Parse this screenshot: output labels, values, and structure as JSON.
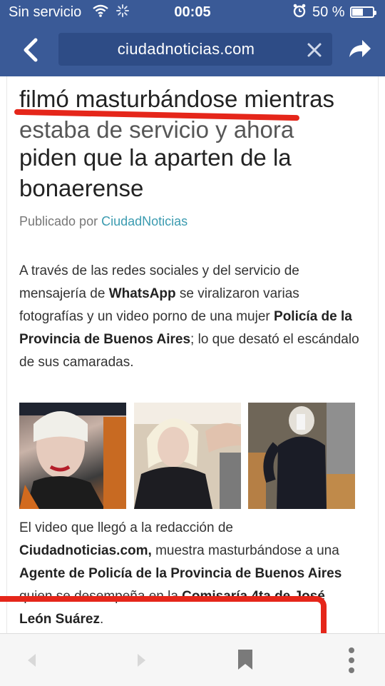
{
  "status_bar": {
    "carrier": "Sin servicio",
    "time": "00:05",
    "battery_percent": "50 %",
    "battery_level": 0.5,
    "icons": [
      "wifi-icon",
      "activity-spinner-icon",
      "alarm-icon",
      "battery-icon"
    ]
  },
  "browser": {
    "url": "ciudadnoticias.com",
    "icons": [
      "back-arrow-icon",
      "clear-icon",
      "share-icon",
      "nav-back-icon",
      "nav-forward-icon",
      "bookmark-icon",
      "more-icon"
    ]
  },
  "article": {
    "headline_line_1": "filmó masturbándose mientras",
    "headline_line_2": "estaba de servicio y ahora",
    "headline_line_3": "piden que la aparten de la",
    "headline_line_4": "bonaerense",
    "byline_prefix": "Publicado por",
    "byline_author": "CiudadNoticias",
    "paragraph_1": {
      "t1": "A través de las redes sociales  y del servicio de mensajería de ",
      "b1": "WhatsApp",
      "t2": " se viralizaron varias fotografías y un video porno de una mujer ",
      "b2": "Policía de la Provincia de Buenos Aires",
      "t3": "; lo que desató el escándalo de sus camaradas."
    },
    "paragraph_2": {
      "t1": "El video que llegó a la redacción de ",
      "b1": "Ciudadnoticias.com,",
      "t2": "   muestra masturbándose  a  una ",
      "b2": "Agente de Policía de la Provincia de Buenos Aires",
      "t3": " quien se desempeña en la ",
      "b3": "Comisaría 4ta de José León Suárez",
      "t4": "."
    }
  },
  "colors": {
    "browser_bar": "#3a5a97",
    "url_field": "#2e4c86",
    "annotation_red": "#e5261a",
    "link": "#3b9bb0"
  }
}
